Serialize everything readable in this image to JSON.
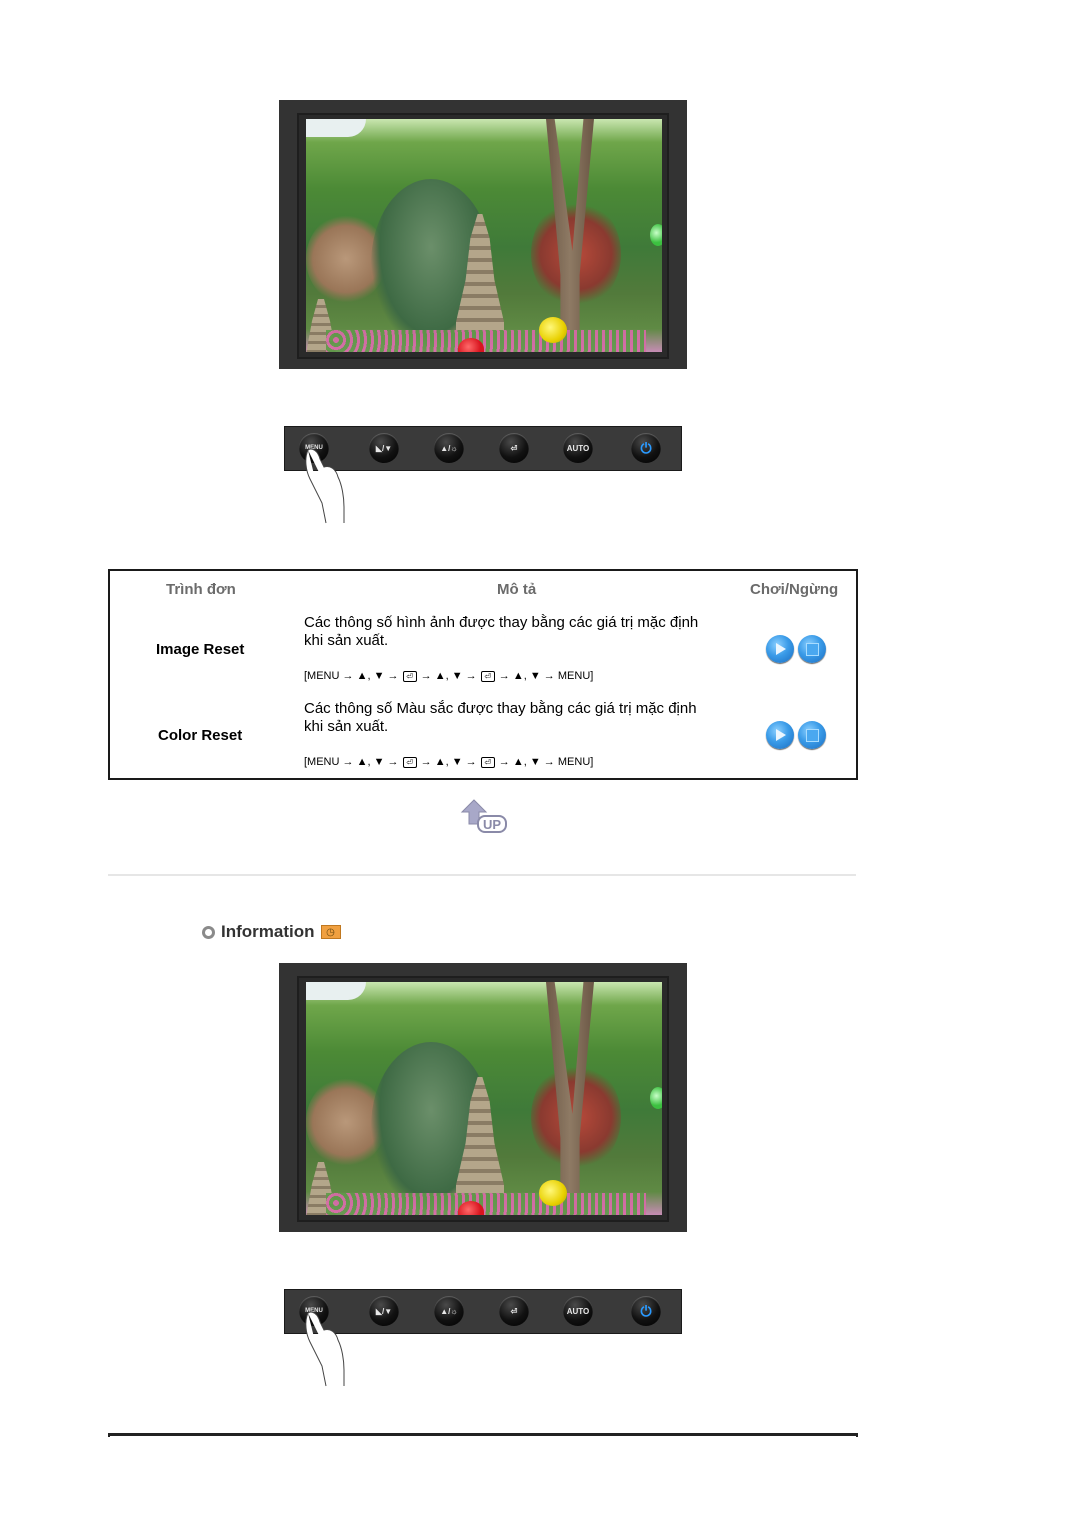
{
  "control_buttons": [
    {
      "name": "menu",
      "label": "MENU",
      "icon": "menu-icon"
    },
    {
      "name": "magic-down",
      "label": "",
      "icon": "magicbright-down-icon"
    },
    {
      "name": "up-brightness",
      "label": "",
      "icon": "up-brightness-icon"
    },
    {
      "name": "enter",
      "label": "",
      "icon": "enter-icon"
    },
    {
      "name": "auto",
      "label": "AUTO",
      "icon": "auto-icon"
    },
    {
      "name": "power",
      "label": "",
      "icon": "power-icon"
    }
  ],
  "table": {
    "headers": {
      "menu": "Trình đơn",
      "description": "Mô tả",
      "play_stop": "Chơi/Ngừng"
    },
    "rows": [
      {
        "name": "Image Reset",
        "description": "Các thông số hình ảnh được thay bằng các giá trị mặc định khi sản xuất.",
        "path": [
          "[MENU",
          "▲, ▼",
          "⏎",
          "▲, ▼",
          "⏎",
          "▲, ▼",
          "MENU]"
        ]
      },
      {
        "name": "Color Reset",
        "description": "Các thông số Màu sắc được thay bằng các giá trị mặc định khi sản xuất.",
        "path": [
          "[MENU",
          "▲, ▼",
          "⏎",
          "▲, ▼",
          "⏎",
          "▲, ▼",
          "MENU]"
        ]
      }
    ]
  },
  "up_link": {
    "label": "UP"
  },
  "section": {
    "title": "Information",
    "icon": "information-icon"
  },
  "colors": {
    "header_text": "#6b6b6b",
    "play_button": "#3a9be8",
    "power_accent": "#2a9aff",
    "info_badge": "#f0a040"
  }
}
